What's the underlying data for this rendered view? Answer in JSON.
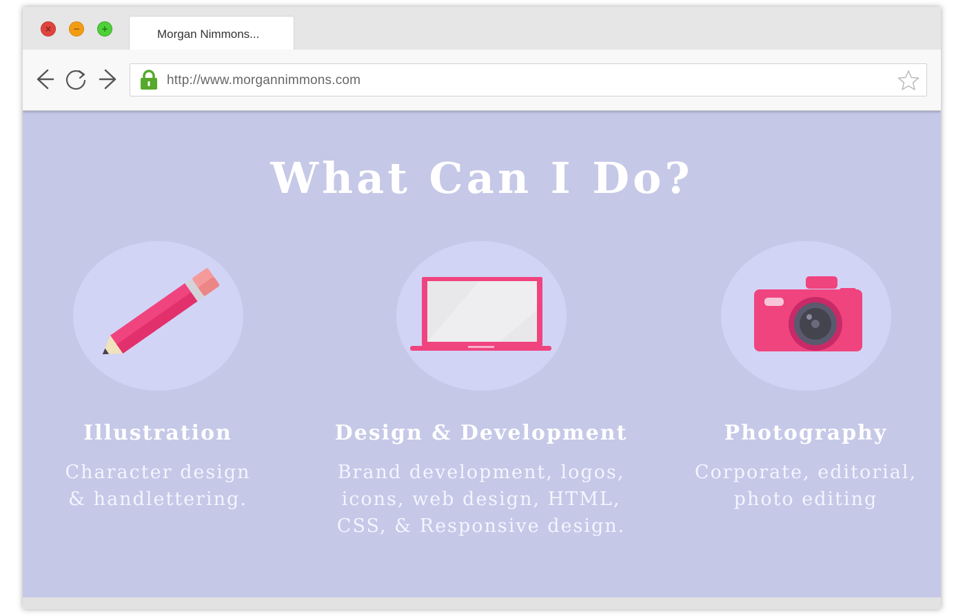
{
  "browser": {
    "tab_title": "Morgan Nimmons...",
    "url": "http://www.morgannimmons.com",
    "controls": {
      "close": "×",
      "minimize": "−",
      "maximize": "+"
    }
  },
  "page": {
    "heading": "What Can I Do?",
    "services": [
      {
        "icon": "pencil-icon",
        "title": "Illustration",
        "description": "Character design\n& handlettering."
      },
      {
        "icon": "laptop-icon",
        "title": "Design & Development",
        "description": "Brand development, logos,\nicons, web design, HTML,\nCSS, & Responsive design."
      },
      {
        "icon": "camera-icon",
        "title": "Photography",
        "description": "Corporate, editorial,\nphoto editing"
      }
    ]
  },
  "colors": {
    "background": "#c5c8e7",
    "icon_circle": "#d2d4f5",
    "accent_pink": "#f0447f",
    "text": "#ffffff"
  }
}
